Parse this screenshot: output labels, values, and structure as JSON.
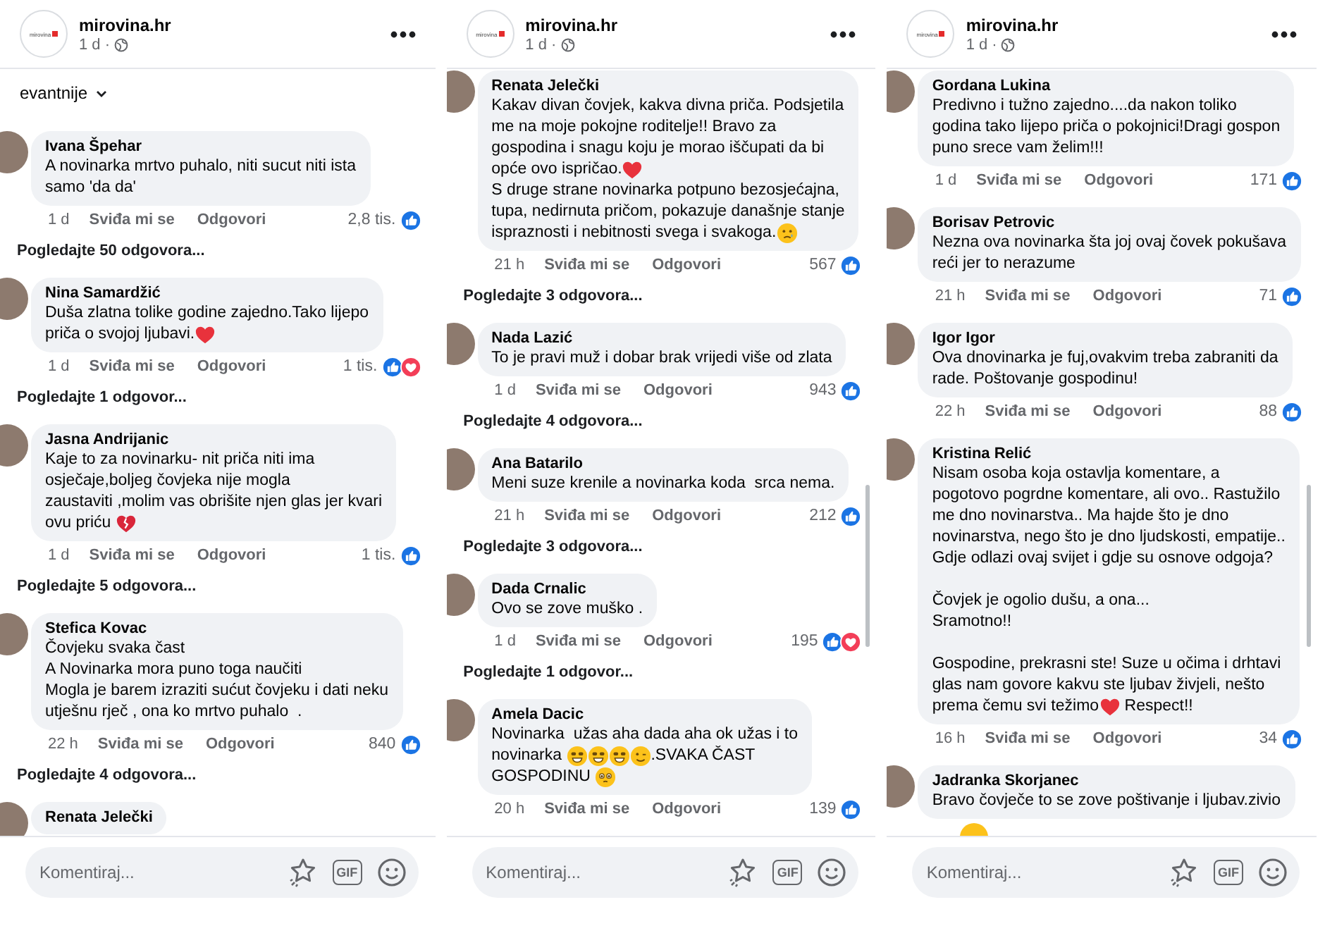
{
  "panels": [
    {
      "page": {
        "name": "mirovina.hr",
        "logo_text": "mirovina",
        "time": "1 d ·"
      },
      "sort_label": "evantnije",
      "scrollbar": false,
      "comments": [
        {
          "author": "Ivana Špehar",
          "paragraphs": [
            [
              [
                "A novinarka mrtvo puhalo, niti sucut niti ista"
              ],
              [
                "samo 'da da'"
              ]
            ]
          ],
          "time": "1 d",
          "like_label": "Sviđa mi se",
          "reply_label": "Odgovori",
          "count": "2,8 tis.",
          "reactions": [
            {
              "kind": "like"
            }
          ],
          "replies_link": "Pogledajte 50 odgovora..."
        },
        {
          "author": "Nina Samardžić",
          "paragraphs": [
            [
              [
                "Duša zlatna tolike godine zajedno.Tako lijepo"
              ],
              [
                "priča o svojoj ljubavi.",
                {
                  "kind": "heart"
                }
              ]
            ]
          ],
          "time": "1 d",
          "like_label": "Sviđa mi se",
          "reply_label": "Odgovori",
          "count": "1 tis.",
          "reactions": [
            {
              "kind": "like"
            },
            {
              "kind": "love"
            }
          ],
          "replies_link": "Pogledajte 1 odgovor..."
        },
        {
          "author": "Jasna Andrijanic",
          "paragraphs": [
            [
              [
                "Kaje to za novinarku- nit priča niti ima"
              ],
              [
                "osječaje,boljeg čovjeka nije mogla"
              ],
              [
                "zaustaviti ,molim vas obrišite njen glas jer kvari"
              ],
              [
                "ovu priću ",
                {
                  "kind": "broken-heart"
                }
              ]
            ]
          ],
          "time": "1 d",
          "like_label": "Sviđa mi se",
          "reply_label": "Odgovori",
          "count": "1 tis.",
          "reactions": [
            {
              "kind": "like"
            }
          ],
          "replies_link": "Pogledajte 5 odgovora..."
        },
        {
          "author": "Stefica Kovac",
          "paragraphs": [
            [
              [
                "Čovjeku svaka čast"
              ],
              [
                "A Novinarka mora puno toga naučiti"
              ],
              [
                "Mogla je barem izraziti sućut čovjeku i dati neku"
              ],
              [
                "utješnu rječ , ona ko mrtvo puhalo  ."
              ]
            ]
          ],
          "time": "22 h",
          "like_label": "Sviđa mi se",
          "reply_label": "Odgovori",
          "count": "840",
          "reactions": [
            {
              "kind": "like"
            }
          ],
          "replies_link": "Pogledajte 4 odgovora..."
        },
        {
          "author": "Renata Jelečki"
        }
      ],
      "composer": {
        "placeholder": "Komentiraj...",
        "gif_label": "GIF"
      }
    },
    {
      "page": {
        "name": "mirovina.hr",
        "logo_text": "mirovina",
        "time": "1 d ·"
      },
      "scrollbar": true,
      "comments": [
        {
          "author": "Renata Jelečki",
          "paragraphs": [
            [
              [
                "Kakav divan čovjek, kakva divna priča. Podsjetila"
              ],
              [
                "me na moje pokojne roditelje!! Bravo za"
              ],
              [
                "gospodina i snagu koju je morao iščupati da bi"
              ],
              [
                "opće ovo ispričao.",
                {
                  "kind": "heart"
                }
              ],
              [
                "S druge strane novinarka potpuno bezosjećajna,"
              ],
              [
                "tupa, nedirnuta pričom, pokazuje današnje stanje"
              ],
              [
                "ispraznosti i nebitnosti svega i svakoga.",
                {
                  "kind": "crying-face"
                }
              ]
            ]
          ],
          "time": "21 h",
          "like_label": "Sviđa mi se",
          "reply_label": "Odgovori",
          "count": "567",
          "reactions": [
            {
              "kind": "like"
            }
          ],
          "replies_link": "Pogledajte 3 odgovora..."
        },
        {
          "author": "Nada Lazić",
          "paragraphs": [
            [
              [
                "To je pravi muž i dobar brak vrijedi više od zlata"
              ]
            ]
          ],
          "time": "1 d",
          "like_label": "Sviđa mi se",
          "reply_label": "Odgovori",
          "count": "943",
          "reactions": [
            {
              "kind": "like"
            }
          ],
          "replies_link": "Pogledajte 4 odgovora..."
        },
        {
          "author": "Ana Batarilo",
          "paragraphs": [
            [
              [
                "Meni suze krenile a novinarka koda  srca nema."
              ]
            ]
          ],
          "time": "21 h",
          "like_label": "Sviđa mi se",
          "reply_label": "Odgovori",
          "count": "212",
          "reactions": [
            {
              "kind": "like"
            }
          ],
          "replies_link": "Pogledajte 3 odgovora..."
        },
        {
          "author": "Dada Crnalic",
          "paragraphs": [
            [
              [
                "Ovo se zove muško ."
              ]
            ]
          ],
          "time": "1 d",
          "like_label": "Sviđa mi se",
          "reply_label": "Odgovori",
          "count": "195",
          "reactions": [
            {
              "kind": "like"
            },
            {
              "kind": "love"
            }
          ],
          "replies_link": "Pogledajte 1 odgovor..."
        },
        {
          "author": "Amela Dacic",
          "paragraphs": [
            [
              [
                "Novinarka  užas aha dada aha ok užas i to"
              ],
              [
                "novinarka ",
                {
                  "kind": "grin-face"
                },
                {
                  "kind": "grin-face"
                },
                {
                  "kind": "grin-face"
                },
                {
                  "kind": "wink-face"
                },
                ".SVAKA ČAST"
              ],
              [
                "GOSPODINU ",
                {
                  "kind": "pleading-face"
                }
              ]
            ]
          ],
          "time": "20 h",
          "like_label": "Sviđa mi se",
          "reply_label": "Odgovori",
          "count": "139",
          "reactions": [
            {
              "kind": "like"
            }
          ]
        }
      ],
      "composer": {
        "placeholder": "Komentiraj...",
        "gif_label": "GIF"
      }
    },
    {
      "page": {
        "name": "mirovina.hr",
        "logo_text": "mirovina",
        "time": "1 d ·"
      },
      "scrollbar": true,
      "comments": [
        {
          "author": "Gordana Lukina",
          "paragraphs": [
            [
              [
                "Predivno i tužno zajedno....da nakon toliko"
              ],
              [
                "godina tako lijepo priča o pokojnici!Dragi gospon"
              ],
              [
                "puno srece vam želim!!!"
              ]
            ]
          ],
          "time": "1 d",
          "like_label": "Sviđa mi se",
          "reply_label": "Odgovori",
          "count": "171",
          "reactions": [
            {
              "kind": "like"
            }
          ]
        },
        {
          "author": "Borisav Petrovic",
          "paragraphs": [
            [
              [
                "Nezna ova novinarka šta joj ovaj čovek pokušava"
              ],
              [
                "reći jer to nerazume"
              ]
            ]
          ],
          "time": "21 h",
          "like_label": "Sviđa mi se",
          "reply_label": "Odgovori",
          "count": "71",
          "reactions": [
            {
              "kind": "like"
            }
          ]
        },
        {
          "author": "Igor Igor",
          "paragraphs": [
            [
              [
                "Ova dnovinarka je fuj,ovakvim treba zabraniti da"
              ],
              [
                "rade. Poštovanje gospodinu!"
              ]
            ]
          ],
          "time": "22 h",
          "like_label": "Sviđa mi se",
          "reply_label": "Odgovori",
          "count": "88",
          "reactions": [
            {
              "kind": "like"
            }
          ]
        },
        {
          "author": "Kristina Relić",
          "paragraphs": [
            [
              [
                "Nisam osoba koja ostavlja komentare, a"
              ],
              [
                "pogotovo pogrdne komentare, ali ovo.. Rastužilo"
              ],
              [
                "me dno novinarstva.. Ma hajde što je dno"
              ],
              [
                "novinarstva, nego što je dno ljudskosti, empatije.."
              ],
              [
                "Gdje odlazi ovaj svijet i gdje su osnove odgoja?"
              ]
            ],
            [
              [
                "Čovjek je ogolio dušu, a ona..."
              ],
              [
                "Sramotno!!"
              ]
            ],
            [
              [
                "Gospodine, prekrasni ste! Suze u očima i drhtavi"
              ],
              [
                "glas nam govore kakvu ste ljubav živjeli, nešto"
              ],
              [
                "prema čemu svi težimo",
                {
                  "kind": "heart"
                },
                " Respect!!"
              ]
            ]
          ],
          "time": "16 h",
          "like_label": "Sviđa mi se",
          "reply_label": "Odgovori",
          "count": "34",
          "reactions": [
            {
              "kind": "like"
            }
          ]
        },
        {
          "author": "Jadranka Skorjanec",
          "paragraphs": [
            [
              [
                "Bravo čovječe to se zove poštivanje i ljubav.zivio"
              ]
            ]
          ],
          "attachment": {
            "kind": "emoji"
          }
        }
      ],
      "composer": {
        "placeholder": "Komentiraj...",
        "gif_label": "GIF"
      }
    }
  ]
}
